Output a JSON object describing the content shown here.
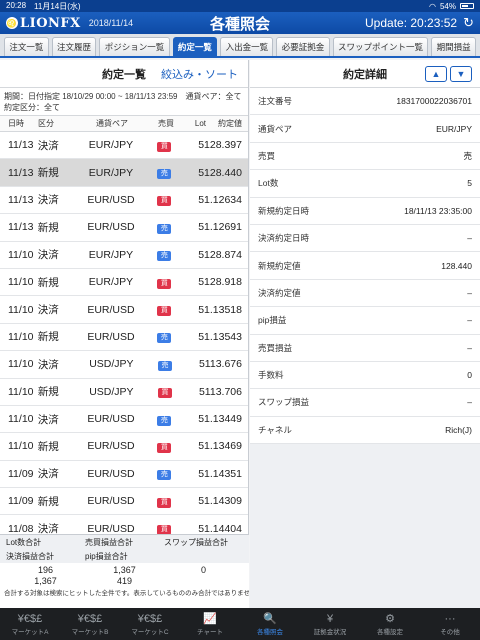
{
  "status": {
    "time": "20:28",
    "date": "11月14日(水)",
    "wifi": "wifi",
    "battery": "54%"
  },
  "header": {
    "logo": "LIONFX",
    "date": "2018/11/14",
    "title": "各種照会",
    "update": "Update: 20:23:52"
  },
  "tabs": [
    "注文一覧",
    "注文履歴",
    "ポジション一覧",
    "約定一覧",
    "入出金一覧",
    "必要証拠金",
    "スワップポイント一覧",
    "期間損益"
  ],
  "active_tab": 3,
  "list": {
    "title": "約定一覧",
    "filter": "絞込み・ソート",
    "period": "期間：日付指定 18/10/29 00:00 ~ 18/11/13 23:59　通貨ペア：全て　約定区分：全て",
    "headers": {
      "date": "日時",
      "kind": "区分",
      "pair": "通貨ペア",
      "side": "売買",
      "lot": "Lot",
      "price": "約定値"
    },
    "rows": [
      {
        "date": "11/13",
        "kind": "決済",
        "pair": "EUR/JPY",
        "side": "買",
        "lot": "5",
        "price": "128.397"
      },
      {
        "date": "11/13",
        "kind": "新規",
        "pair": "EUR/JPY",
        "side": "売",
        "lot": "5",
        "price": "128.440"
      },
      {
        "date": "11/13",
        "kind": "決済",
        "pair": "EUR/USD",
        "side": "買",
        "lot": "5",
        "price": "1.12634"
      },
      {
        "date": "11/13",
        "kind": "新規",
        "pair": "EUR/USD",
        "side": "売",
        "lot": "5",
        "price": "1.12691"
      },
      {
        "date": "11/10",
        "kind": "決済",
        "pair": "EUR/JPY",
        "side": "売",
        "lot": "5",
        "price": "128.874"
      },
      {
        "date": "11/10",
        "kind": "新規",
        "pair": "EUR/JPY",
        "side": "買",
        "lot": "5",
        "price": "128.918"
      },
      {
        "date": "11/10",
        "kind": "決済",
        "pair": "EUR/USD",
        "side": "買",
        "lot": "5",
        "price": "1.13518"
      },
      {
        "date": "11/10",
        "kind": "新規",
        "pair": "EUR/USD",
        "side": "売",
        "lot": "5",
        "price": "1.13543"
      },
      {
        "date": "11/10",
        "kind": "決済",
        "pair": "USD/JPY",
        "side": "売",
        "lot": "5",
        "price": "113.676"
      },
      {
        "date": "11/10",
        "kind": "新規",
        "pair": "USD/JPY",
        "side": "買",
        "lot": "5",
        "price": "113.706"
      },
      {
        "date": "11/10",
        "kind": "決済",
        "pair": "EUR/USD",
        "side": "売",
        "lot": "5",
        "price": "1.13449"
      },
      {
        "date": "11/10",
        "kind": "新規",
        "pair": "EUR/USD",
        "side": "買",
        "lot": "5",
        "price": "1.13469"
      },
      {
        "date": "11/09",
        "kind": "決済",
        "pair": "EUR/USD",
        "side": "売",
        "lot": "5",
        "price": "1.14351"
      },
      {
        "date": "11/09",
        "kind": "新規",
        "pair": "EUR/USD",
        "side": "買",
        "lot": "5",
        "price": "1.14309"
      },
      {
        "date": "11/08",
        "kind": "決済",
        "pair": "EUR/USD",
        "side": "買",
        "lot": "5",
        "price": "1.14404"
      }
    ],
    "selected_row": 1
  },
  "summary": {
    "labels": [
      "Lot数合計",
      "売買損益合計",
      "スワップ損益合計",
      "決済損益合計",
      "pip損益合計",
      ""
    ],
    "values": [
      "196",
      "1,367",
      "0",
      "1,367",
      "419",
      ""
    ],
    "note": "合計する対象は検索にヒットした全件です。表示しているもののみ合計ではありません。"
  },
  "detail": {
    "title": "約定詳細",
    "rows": [
      {
        "label": "注文番号",
        "value": "1831700022036701"
      },
      {
        "label": "通貨ペア",
        "value": "EUR/JPY"
      },
      {
        "label": "売買",
        "value": "売"
      },
      {
        "label": "Lot数",
        "value": "5"
      },
      {
        "label": "新規約定日時",
        "value": "18/11/13 23:35:00"
      },
      {
        "label": "決済約定日時",
        "value": "–"
      },
      {
        "label": "新規約定値",
        "value": "128.440"
      },
      {
        "label": "決済約定値",
        "value": "–"
      },
      {
        "label": "pip損益",
        "value": "–"
      },
      {
        "label": "売買損益",
        "value": "–"
      },
      {
        "label": "手数料",
        "value": "0"
      },
      {
        "label": "スワップ損益",
        "value": "–"
      },
      {
        "label": "チャネル",
        "value": "Rich(J)"
      }
    ]
  },
  "bottom_nav": [
    {
      "label": "マーケットA",
      "icon": "¥€$£",
      "name": "market-a"
    },
    {
      "label": "マーケットB",
      "icon": "¥€$£",
      "name": "market-b"
    },
    {
      "label": "マーケットC",
      "icon": "¥€$£",
      "name": "market-c"
    },
    {
      "label": "チャート",
      "icon": "📈",
      "name": "chart"
    },
    {
      "label": "各種照会",
      "icon": "🔍",
      "name": "inquiry"
    },
    {
      "label": "証拠金状況",
      "icon": "¥",
      "name": "margin-status"
    },
    {
      "label": "各種設定",
      "icon": "⚙",
      "name": "settings"
    },
    {
      "label": "その他",
      "icon": "···",
      "name": "other"
    }
  ],
  "active_nav": 4,
  "colors": {
    "brand": "#1b5fbf",
    "buy": "#e0344a",
    "sell": "#3c7de6",
    "nav_active": "#3d8cf0"
  }
}
